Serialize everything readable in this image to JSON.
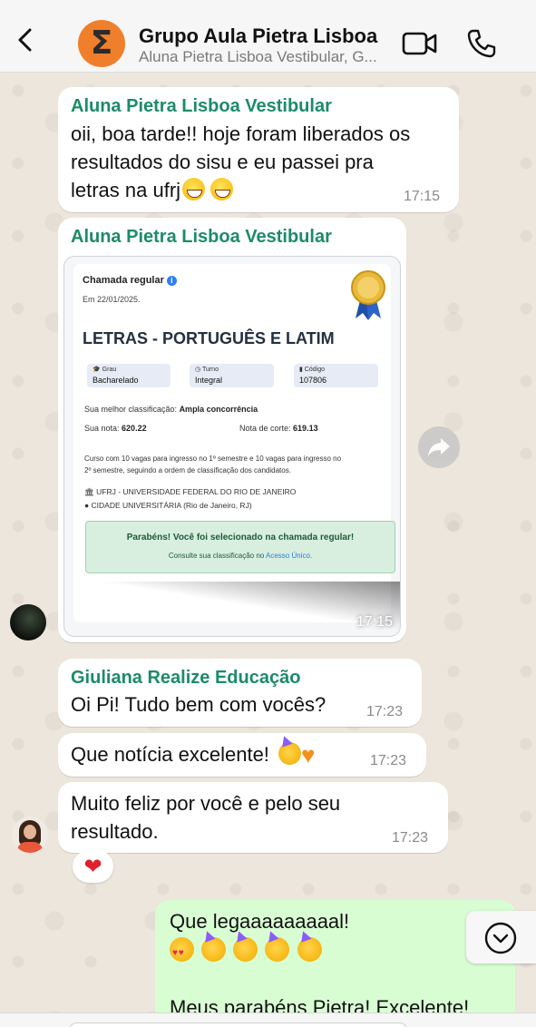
{
  "header": {
    "title": "Grupo Aula Pietra Lisboa",
    "subtitle": "Aluna Pietra Lisboa Vestibular, G...",
    "avatar_glyph": "Σ",
    "avatar_color": "#f07f2c"
  },
  "messages": [
    {
      "sender": "Aluna Pietra Lisboa Vestibular",
      "text_lines": [
        "oii, boa tarde!! hoje foram liberados os",
        "resultados do sisu e eu passei pra",
        "letras na ufrj"
      ],
      "time": "17:15"
    },
    {
      "sender": "Aluna Pietra Lisboa Vestibular",
      "time": "17:15",
      "image_card": {
        "heading": "Chamada regular",
        "date": "Em 22/01/2025.",
        "course": "LETRAS - PORTUGUÊS E LATIM",
        "fields": [
          {
            "label": "Grau",
            "value": "Bacharelado"
          },
          {
            "label": "Turno",
            "value": "Integral"
          },
          {
            "label": "Código",
            "value": "107806"
          }
        ],
        "classification_label": "Sua melhor classificação:",
        "classification_value": "Ampla concorrência",
        "score_label": "Sua nota:",
        "score_value": "620.22",
        "cutoff_label": "Nota de corte:",
        "cutoff_value": "619.13",
        "vacancies_line1": "Curso com 10 vagas para ingresso no 1º semestre e 10 vagas para ingresso no",
        "vacancies_line2": "2º semestre, seguindo a ordem de classificação dos candidatos.",
        "university": "UFRJ - UNIVERSIDADE FEDERAL DO RIO DE JANEIRO",
        "campus": "CIDADE UNIVERSITÁRIA (Rio de Janeiro, RJ)",
        "success_title": "Parabéns! Você foi selecionado na chamada regular!",
        "success_sub_prefix": "Consulte sua classificação no",
        "success_sub_link": "Acesso Único."
      }
    },
    {
      "sender": "Giuliana Realize Educação",
      "text": "Oi Pi! Tudo bem com vocês?",
      "time": "17:23"
    },
    {
      "text": "Que notícia excelente!",
      "time": "17:23"
    },
    {
      "text_lines": [
        "Muito feliz por você e pelo seu",
        "resultado."
      ],
      "time": "17:23",
      "reaction": "❤"
    },
    {
      "outgoing": true,
      "text_line1": "Que legaaaaaaaaal!",
      "text_line3": "Meus parabéns Pietra! Excelente!"
    }
  ],
  "icons": {
    "back": "chevron-left-icon",
    "video": "video-camera-icon",
    "call": "phone-icon",
    "forward": "forward-arrow-icon",
    "scroll": "chevron-down-icon"
  }
}
